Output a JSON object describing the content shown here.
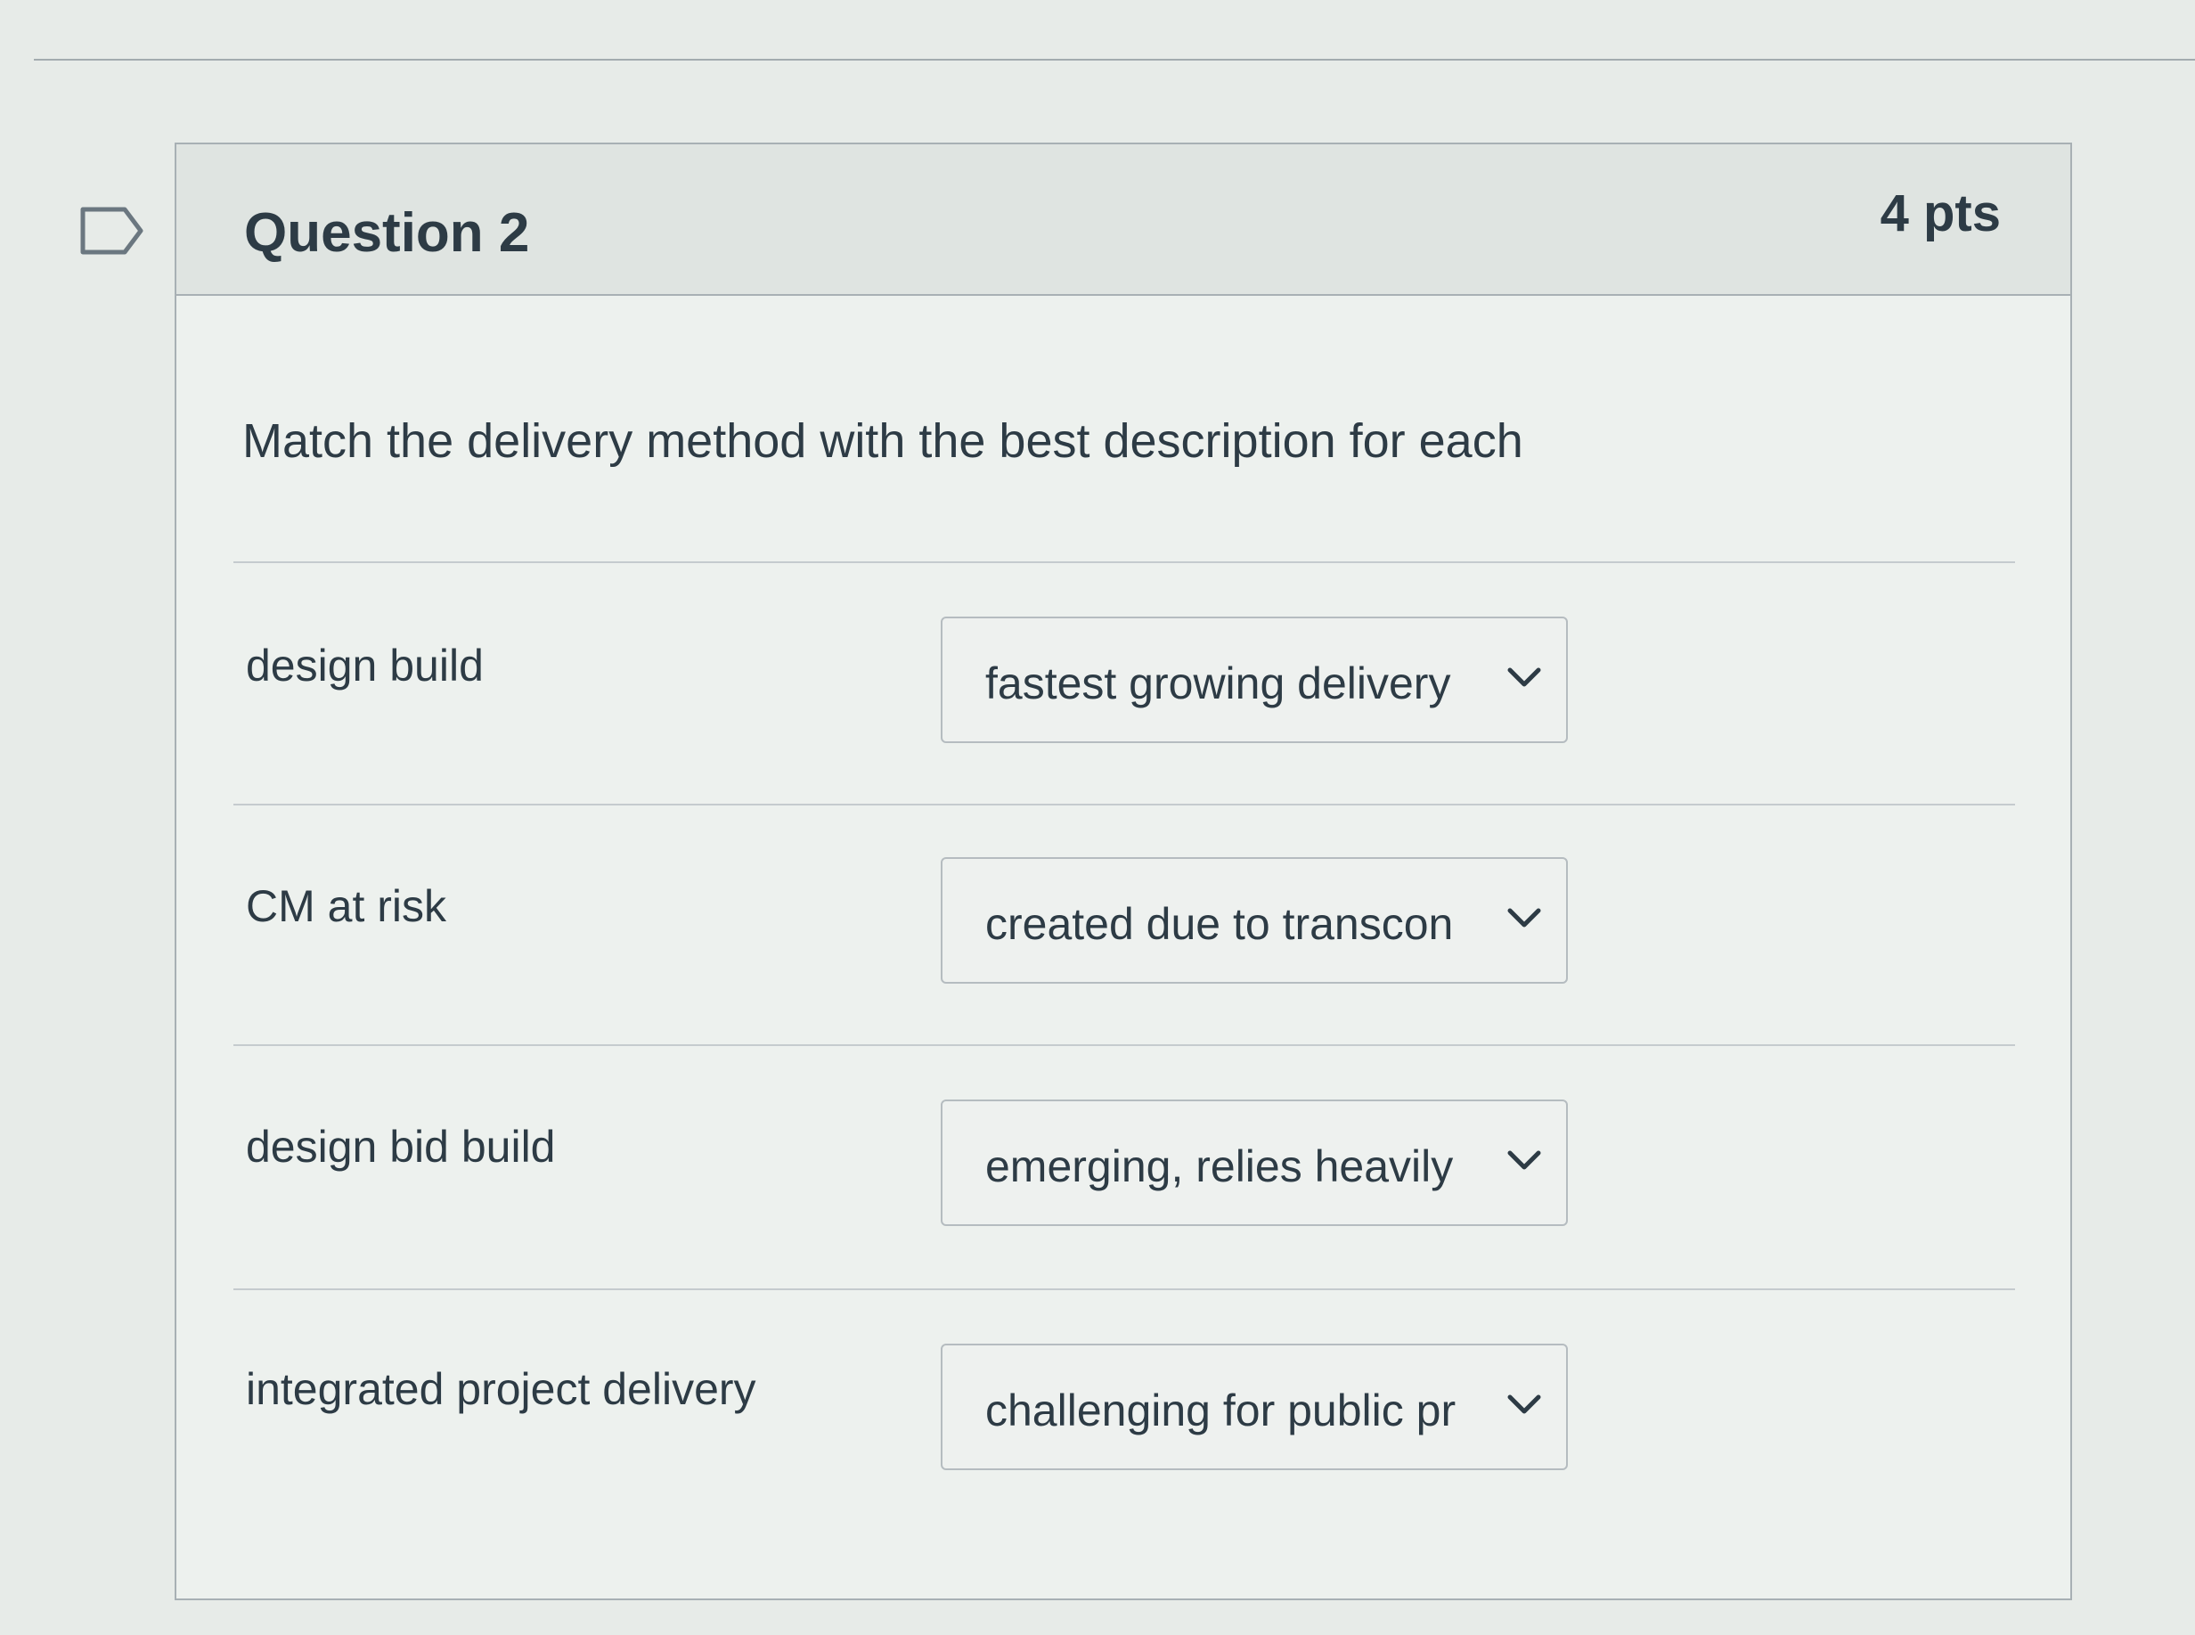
{
  "question": {
    "title": "Question 2",
    "points": "4 pts",
    "prompt": "Match the delivery method with the best description for each"
  },
  "answers": [
    {
      "label": "design build",
      "selected": "fastest growing delivery"
    },
    {
      "label": "CM at risk",
      "selected": "created due to transcon"
    },
    {
      "label": "design bid build",
      "selected": "emerging, relies heavily"
    },
    {
      "label": "integrated project delivery",
      "selected": "challenging for public pr"
    }
  ],
  "icons": {
    "flag": "bookmark-flag-icon",
    "dropdown": "chevron-down-icon"
  },
  "colors": {
    "text": "#2d3b45",
    "border": "#a8b0b4",
    "background": "#e7ebe8"
  }
}
